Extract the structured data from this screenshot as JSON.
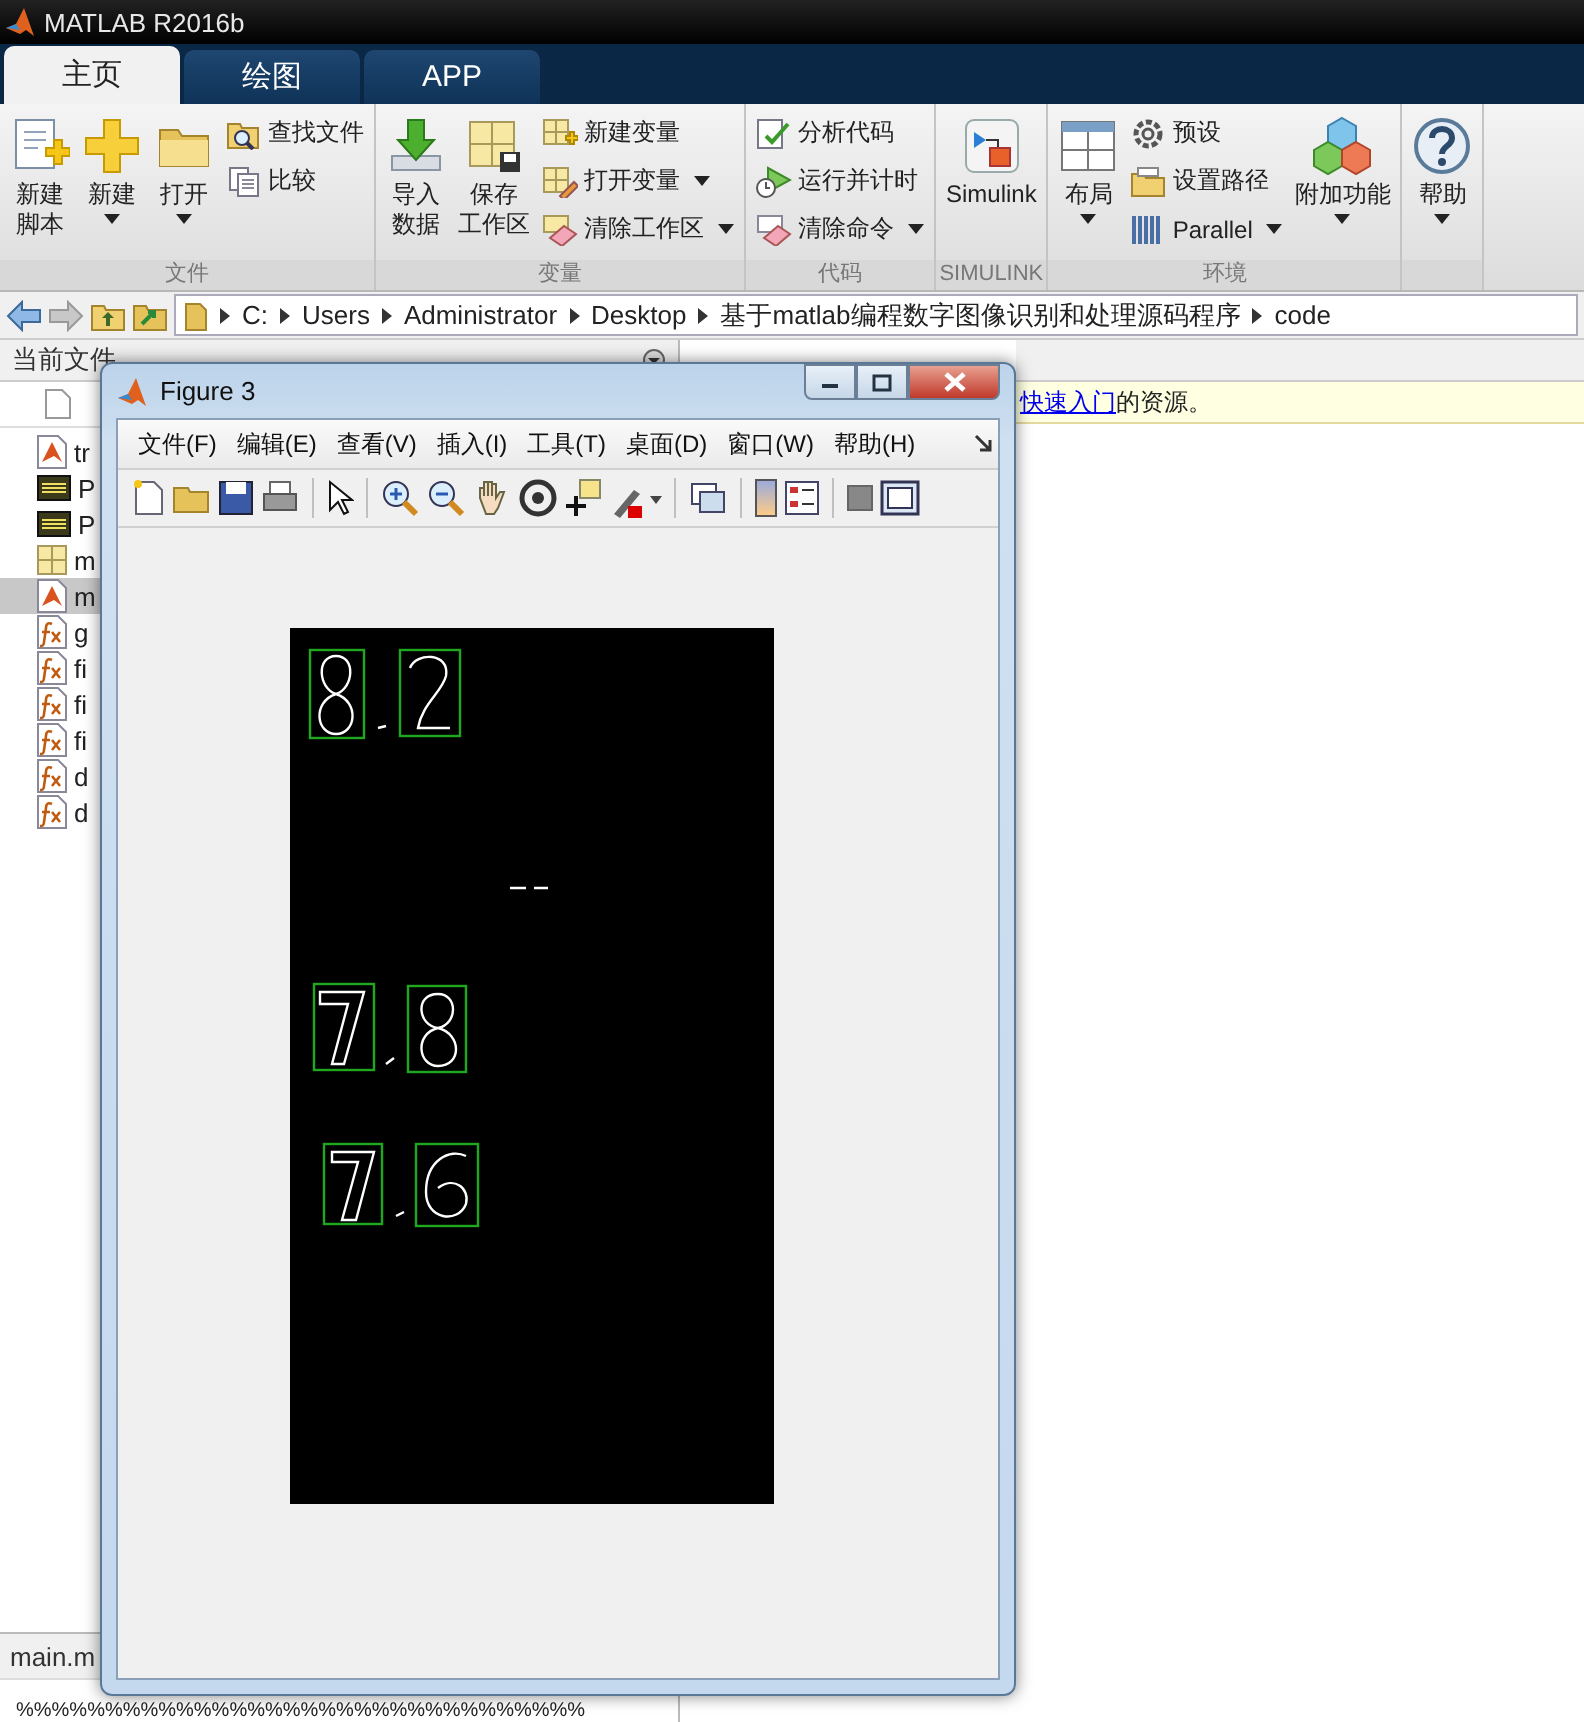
{
  "app_title": "MATLAB R2016b",
  "tabs": [
    {
      "label": "主页",
      "selected": true
    },
    {
      "label": "绘图",
      "selected": false
    },
    {
      "label": "APP",
      "selected": false
    }
  ],
  "ribbon": {
    "sections": [
      {
        "title": "文件",
        "items": [
          {
            "kind": "large",
            "lines": [
              "新建",
              "脚本"
            ],
            "dropdown": false
          },
          {
            "kind": "large",
            "lines": [
              "新建"
            ],
            "dropdown": true
          },
          {
            "kind": "large",
            "lines": [
              "打开"
            ],
            "dropdown": true
          },
          {
            "kind": "small",
            "lines": [
              "查找文件"
            ],
            "dropdown": false
          },
          {
            "kind": "small",
            "lines": [
              "比较"
            ],
            "dropdown": false
          }
        ]
      },
      {
        "title": "变量",
        "items": [
          {
            "kind": "large",
            "lines": [
              "导入",
              "数据"
            ],
            "dropdown": false
          },
          {
            "kind": "large",
            "lines": [
              "保存",
              "工作区"
            ],
            "dropdown": false
          },
          {
            "kind": "small",
            "lines": [
              "新建变量"
            ],
            "dropdown": false
          },
          {
            "kind": "small",
            "lines": [
              "打开变量"
            ],
            "dropdown": true
          },
          {
            "kind": "small",
            "lines": [
              "清除工作区"
            ],
            "dropdown": true
          }
        ]
      },
      {
        "title": "代码",
        "items": [
          {
            "kind": "small",
            "lines": [
              "分析代码"
            ],
            "dropdown": false
          },
          {
            "kind": "small",
            "lines": [
              "运行并计时"
            ],
            "dropdown": false
          },
          {
            "kind": "small",
            "lines": [
              "清除命令"
            ],
            "dropdown": true
          }
        ]
      },
      {
        "title": "SIMULINK",
        "items": [
          {
            "kind": "large",
            "lines": [
              "Simulink"
            ],
            "dropdown": false
          }
        ]
      },
      {
        "title": "环境",
        "items": [
          {
            "kind": "large",
            "lines": [
              "布局"
            ],
            "dropdown": true
          },
          {
            "kind": "small",
            "lines": [
              "预设"
            ],
            "dropdown": false
          },
          {
            "kind": "small",
            "lines": [
              "设置路径"
            ],
            "dropdown": false
          },
          {
            "kind": "small",
            "lines": [
              "Parallel"
            ],
            "dropdown": true
          },
          {
            "kind": "large",
            "lines": [
              "附加功能"
            ],
            "dropdown": true
          }
        ]
      },
      {
        "items": [
          {
            "kind": "large",
            "lines": [
              "帮助"
            ],
            "dropdown": true
          }
        ]
      }
    ]
  },
  "path": [
    "C:",
    "Users",
    "Administrator",
    "Desktop",
    "基于matlab编程数字图像识别和处理源码程序",
    "code"
  ],
  "current_folder": {
    "title": "当前文件",
    "files": [
      {
        "kind": "mfile",
        "name": "tr",
        "selected": false
      },
      {
        "kind": "jpg",
        "name": "P",
        "selected": false
      },
      {
        "kind": "jpg",
        "name": "P",
        "selected": false
      },
      {
        "kind": "mat",
        "name": "m",
        "selected": false
      },
      {
        "kind": "mfile",
        "name": "m",
        "selected": true
      },
      {
        "kind": "function",
        "name": "g",
        "selected": false
      },
      {
        "kind": "function",
        "name": "fi",
        "selected": false
      },
      {
        "kind": "function",
        "name": "fi",
        "selected": false
      },
      {
        "kind": "function",
        "name": "fi",
        "selected": false
      },
      {
        "kind": "function",
        "name": "d",
        "selected": false
      },
      {
        "kind": "function",
        "name": "d",
        "selected": false
      }
    ],
    "details_title": "main.m",
    "preview": "%%%%%%%%%%%%%%%%%%%%%%%%%%%%%%%%"
  },
  "command_window": {
    "notice_link": "快速入门",
    "notice_text": "的资源。"
  },
  "figure": {
    "title": "Figure 3",
    "menu": [
      "文件(F)",
      "编辑(E)",
      "查看(V)",
      "插入(I)",
      "工具(T)",
      "桌面(D)",
      "窗口(W)",
      "帮助(H)"
    ]
  }
}
